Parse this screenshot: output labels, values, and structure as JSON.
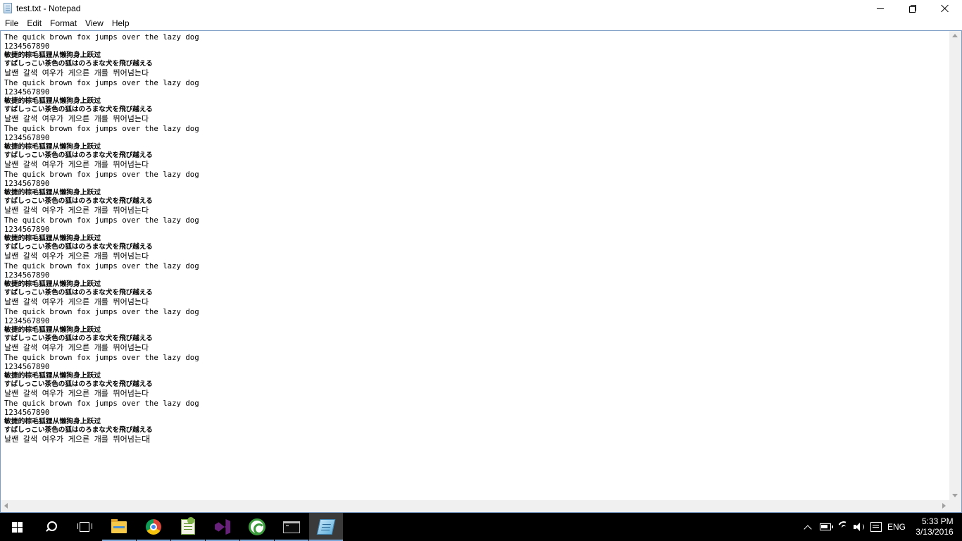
{
  "window": {
    "title": "test.txt - Notepad"
  },
  "menu": [
    "File",
    "Edit",
    "Format",
    "View",
    "Help"
  ],
  "editor": {
    "lines": [
      {
        "text": "The quick brown fox jumps over the lazy dog",
        "kind": "latin"
      },
      {
        "text": "1234567890",
        "kind": "latin"
      },
      {
        "text": "敏捷的棕毛狐狸从懒狗身上跃过",
        "kind": "cjk"
      },
      {
        "text": "すばしっこい茶色の狐はのろまな犬を飛び越える",
        "kind": "jp"
      },
      {
        "text": "날쌘 갈색 여우가 게으른 개를 뛰어넘는다",
        "kind": "ko"
      },
      {
        "text": "The quick brown fox jumps over the lazy dog",
        "kind": "latin"
      },
      {
        "text": "1234567890",
        "kind": "latin"
      },
      {
        "text": "敏捷的棕毛狐狸从懒狗身上跃过",
        "kind": "cjk"
      },
      {
        "text": "すばしっこい茶色の狐はのろまな犬を飛び越える",
        "kind": "jp"
      },
      {
        "text": "날쌘 갈색 여우가 게으른 개를 뛰어넘는다",
        "kind": "ko"
      },
      {
        "text": "The quick brown fox jumps over the lazy dog",
        "kind": "latin"
      },
      {
        "text": "1234567890",
        "kind": "latin"
      },
      {
        "text": "敏捷的棕毛狐狸从懒狗身上跃过",
        "kind": "cjk"
      },
      {
        "text": "すばしっこい茶色の狐はのろまな犬を飛び越える",
        "kind": "jp"
      },
      {
        "text": "날쌘 갈색 여우가 게으른 개를 뛰어넘는다",
        "kind": "ko"
      },
      {
        "text": "The quick brown fox jumps over the lazy dog",
        "kind": "latin"
      },
      {
        "text": "1234567890",
        "kind": "latin"
      },
      {
        "text": "敏捷的棕毛狐狸从懒狗身上跃过",
        "kind": "cjk"
      },
      {
        "text": "すばしっこい茶色の狐はのろまな犬を飛び越える",
        "kind": "jp"
      },
      {
        "text": "날쌘 갈색 여우가 게으른 개를 뛰어넘는다",
        "kind": "ko"
      },
      {
        "text": "The quick brown fox jumps over the lazy dog",
        "kind": "latin"
      },
      {
        "text": "1234567890",
        "kind": "latin"
      },
      {
        "text": "敏捷的棕毛狐狸从懒狗身上跃过",
        "kind": "cjk"
      },
      {
        "text": "すばしっこい茶色の狐はのろまな犬を飛び越える",
        "kind": "jp"
      },
      {
        "text": "날쌘 갈색 여우가 게으른 개를 뛰어넘는다",
        "kind": "ko"
      },
      {
        "text": "The quick brown fox jumps over the lazy dog",
        "kind": "latin"
      },
      {
        "text": "1234567890",
        "kind": "latin"
      },
      {
        "text": "敏捷的棕毛狐狸从懒狗身上跃过",
        "kind": "cjk"
      },
      {
        "text": "すばしっこい茶色の狐はのろまな犬を飛び越える",
        "kind": "jp"
      },
      {
        "text": "날쌘 갈색 여우가 게으른 개를 뛰어넘는다",
        "kind": "ko"
      },
      {
        "text": "The quick brown fox jumps over the lazy dog",
        "kind": "latin"
      },
      {
        "text": "1234567890",
        "kind": "latin"
      },
      {
        "text": "敏捷的棕毛狐狸从懒狗身上跃过",
        "kind": "cjk"
      },
      {
        "text": "すばしっこい茶色の狐はのろまな犬を飛び越える",
        "kind": "jp"
      },
      {
        "text": "날쌘 갈색 여우가 게으른 개를 뛰어넘는다",
        "kind": "ko"
      },
      {
        "text": "The quick brown fox jumps over the lazy dog",
        "kind": "latin"
      },
      {
        "text": "1234567890",
        "kind": "latin"
      },
      {
        "text": "敏捷的棕毛狐狸从懒狗身上跃过",
        "kind": "cjk"
      },
      {
        "text": "すばしっこい茶色の狐はのろまな犬を飛び越える",
        "kind": "jp"
      },
      {
        "text": "날쌘 갈색 여우가 게으른 개를 뛰어넘는다",
        "kind": "ko"
      },
      {
        "text": "The quick brown fox jumps over the lazy dog",
        "kind": "latin"
      },
      {
        "text": "1234567890",
        "kind": "latin"
      },
      {
        "text": "敏捷的棕毛狐狸从懒狗身上跃过",
        "kind": "cjk"
      },
      {
        "text": "すばしっこい茶色の狐はのろまな犬を飛び越える",
        "kind": "jp"
      },
      {
        "text": "날쌘 갈색 여우가 게으른 개를 뛰어넘는다",
        "kind": "ko"
      }
    ]
  },
  "taskbar": {
    "apps": [
      {
        "name": "start-button",
        "icon": "windows-logo-icon"
      },
      {
        "name": "search-button",
        "icon": "search-icon"
      },
      {
        "name": "task-view-button",
        "icon": "task-view-icon"
      },
      {
        "name": "file-explorer-button",
        "icon": "folder-icon"
      },
      {
        "name": "chrome-button",
        "icon": "chrome-icon"
      },
      {
        "name": "notepad-plus-plus-button",
        "icon": "notepad-plus-plus-icon"
      },
      {
        "name": "visual-studio-button",
        "icon": "visual-studio-icon"
      },
      {
        "name": "recycle-app-button",
        "icon": "recycle-icon"
      },
      {
        "name": "command-prompt-button",
        "icon": "command-prompt-icon"
      },
      {
        "name": "notepad-button",
        "icon": "notepad-icon"
      }
    ],
    "language": "ENG",
    "time": "5:33 PM",
    "date": "3/13/2016"
  },
  "colors": {
    "taskbar": "#000000",
    "editor_border": "#7a9cc4",
    "running_indicator": "#7aa7d8"
  }
}
